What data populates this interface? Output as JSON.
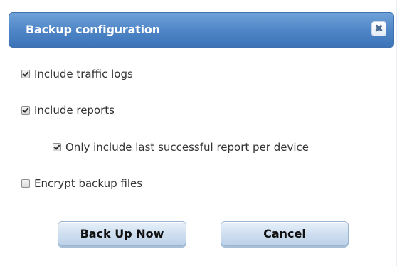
{
  "dialog": {
    "title": "Backup configuration",
    "close_icon": "close-icon"
  },
  "options": [
    {
      "label": "Include traffic logs",
      "checked": true
    },
    {
      "label": "Include reports",
      "checked": true
    },
    {
      "label": "Only include last successful report per device",
      "checked": true
    },
    {
      "label": "Encrypt backup files",
      "checked": false
    }
  ],
  "buttons": {
    "backup_label": "Back Up Now",
    "cancel_label": "Cancel"
  },
  "colors": {
    "titlebar": "#4d84c6",
    "title_text": "#ffffff",
    "button_fill": "#cfdff0"
  }
}
